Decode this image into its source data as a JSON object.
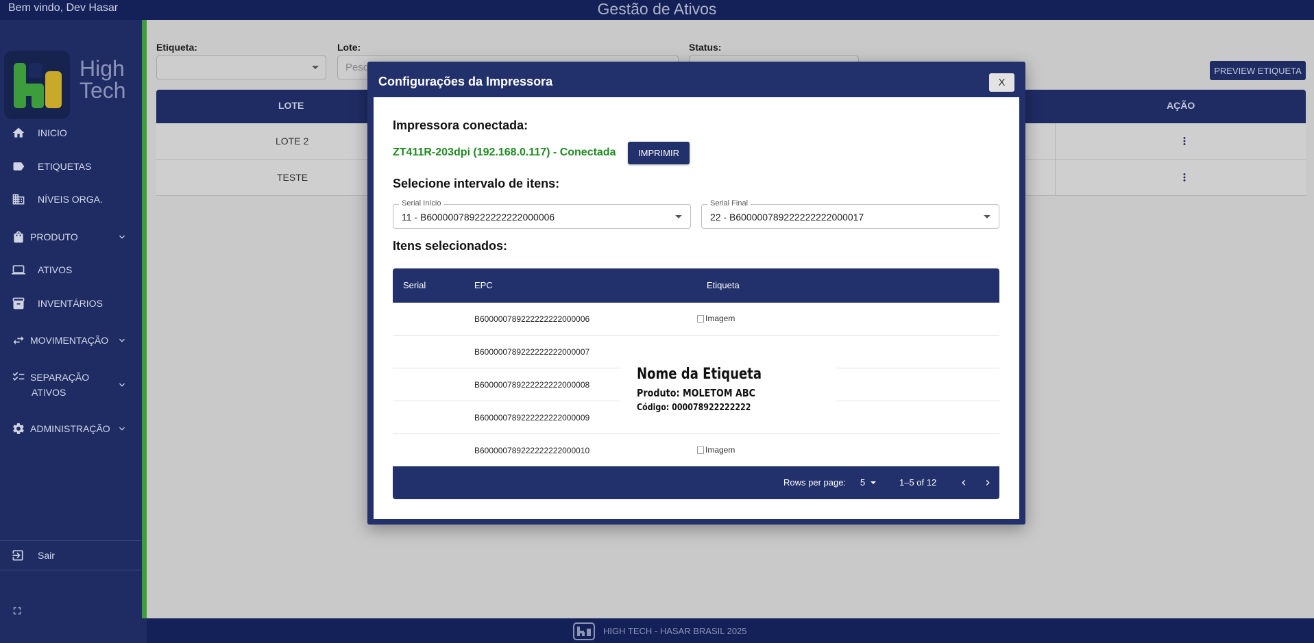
{
  "topbar": {
    "welcome": "Bem vindo, Dev Hasar",
    "title": "Gestão de Ativos"
  },
  "brand": {
    "name_line1": "High",
    "name_line2": "Tech",
    "colors": {
      "navy": "#1f2c64",
      "green": "#3d9c3b",
      "yellow": "#c8a92a"
    }
  },
  "sidebar": {
    "items": [
      {
        "label": "INICIO",
        "icon": "home-icon"
      },
      {
        "label": "ETIQUETAS",
        "icon": "label-icon"
      },
      {
        "label": "NÍVEIS ORGA.",
        "icon": "building-icon"
      },
      {
        "label": "PRODUTO",
        "icon": "bag-icon",
        "expandable": true
      },
      {
        "label": "ATIVOS",
        "icon": "laptop-icon"
      },
      {
        "label": "INVENTÁRIOS",
        "icon": "archive-icon"
      },
      {
        "label": "MOVIMENTAÇÃO",
        "icon": "swap-icon",
        "expandable": true
      },
      {
        "label": "SEPARAÇÃO",
        "label2": "ATIVOS",
        "icon": "checklist-icon",
        "expandable": true
      },
      {
        "label": "ADMINISTRAÇÃO",
        "icon": "gear-icon",
        "expandable": true
      }
    ],
    "logout": "Sair"
  },
  "filters": {
    "etiqueta_label": "Etiqueta:",
    "lote_label": "Lote:",
    "lote_placeholder": "Pesq",
    "status_label": "Status:"
  },
  "preview_button": "PREVIEW ETIQUETA",
  "main_table": {
    "headers": {
      "lote": "LOTE",
      "acao": "AÇÃO"
    },
    "rows": [
      {
        "lote": "LOTE 2"
      },
      {
        "lote": "TESTE"
      }
    ]
  },
  "footer": {
    "text": "HIGH TECH - HASAR BRASIL 2025"
  },
  "dialog": {
    "title": "Configurações da Impressora",
    "close_label": "X",
    "printer_section": "Impressora conectada:",
    "printer_name": "ZT411R-203dpi (192.168.0.117) - Conectada",
    "print_button": "IMPRIMIR",
    "range_section": "Selecione intervalo de itens:",
    "serial_start": {
      "legend": "Serial Início",
      "value": "11 - B600000789222222222000006"
    },
    "serial_end": {
      "legend": "Serial Final",
      "value": "22 - B600000789222222222000017"
    },
    "selected_section": "Itens selecionados:",
    "items_table": {
      "headers": {
        "serial": "Serial",
        "epc": "EPC",
        "etiqueta": "Etiqueta"
      },
      "rows": [
        {
          "epc": "B600000789222222222000006",
          "etiqueta": "Imagem"
        },
        {
          "epc": "B600000789222222222000007",
          "etiqueta": ""
        },
        {
          "epc": "B600000789222222222000008",
          "etiqueta": ""
        },
        {
          "epc": "B600000789222222222000009",
          "etiqueta": ""
        },
        {
          "epc": "B600000789222222222000010",
          "etiqueta": "Imagem"
        }
      ],
      "rows_per_page_label": "Rows per page:",
      "rows_per_page": "5",
      "range": "1–5 of 12"
    },
    "label_preview": {
      "title": "Nome da Etiqueta",
      "product": "Produto: MOLETOM ABC",
      "code": "Código: 000078922222222"
    }
  }
}
